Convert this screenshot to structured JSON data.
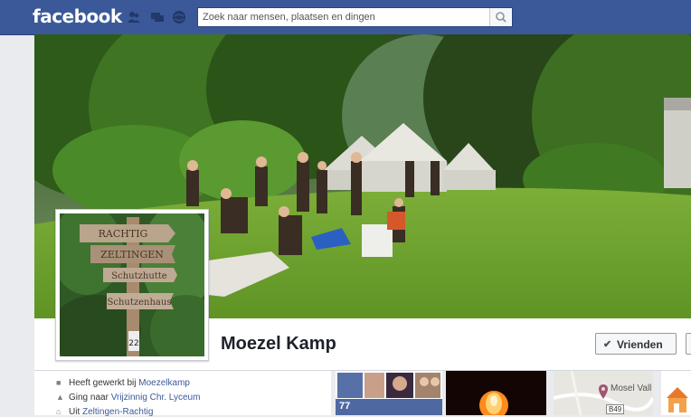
{
  "header": {
    "logo": "facebook",
    "search": {
      "placeholder": "Zoek naar mensen, plaatsen en dingen"
    },
    "jewels": [
      "friend-requests-icon",
      "messages-icon",
      "notifications-icon"
    ]
  },
  "profile": {
    "name": "Moezel Kamp",
    "friends_button": "Vrienden",
    "sign_lines": [
      "RACHTIG",
      "ZELTINGEN",
      "Schutzhutte",
      "Schutzenhaus"
    ],
    "sign_post_number": "22"
  },
  "about": {
    "items": [
      {
        "icon": "work-icon",
        "prefix": "Heeft gewerkt bij ",
        "link": "Moezelkamp"
      },
      {
        "icon": "education-icon",
        "prefix": "Ging naar ",
        "link": "Vrijzinnig Chr. Lyceum"
      },
      {
        "icon": "home-icon",
        "prefix": "Uit ",
        "link": "Zeltingen-Rachtig"
      }
    ]
  },
  "tiles": {
    "friends_count": "77",
    "map_label": "Mosel Vall",
    "map_road": "B49"
  },
  "colors": {
    "brand": "#3b5998",
    "link": "#3b5998",
    "grass": "#6fa130"
  }
}
